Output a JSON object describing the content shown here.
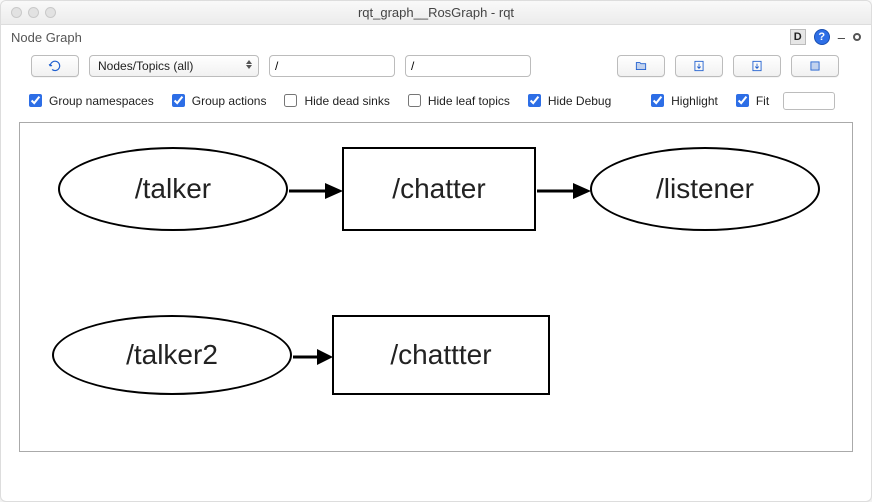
{
  "window": {
    "title": "rqt_graph__RosGraph - rqt",
    "panel_label": "Node Graph",
    "d_button": "D",
    "help_button": "?",
    "minimize": "–",
    "restore": "O"
  },
  "toolbar": {
    "dropdown_value": "Nodes/Topics (all)",
    "filter1": "/",
    "filter2": "/"
  },
  "checks": {
    "group_namespaces": "Group namespaces",
    "group_actions": "Group actions",
    "hide_dead_sinks": "Hide dead sinks",
    "hide_leaf_topics": "Hide leaf topics",
    "hide_debug": "Hide Debug",
    "highlight": "Highlight",
    "fit": "Fit"
  },
  "check_states": {
    "group_namespaces": true,
    "group_actions": true,
    "hide_dead_sinks": false,
    "hide_leaf_topics": false,
    "hide_debug": true,
    "highlight": true,
    "fit": true
  },
  "graph": {
    "nodes": {
      "talker": "/talker",
      "chatter": "/chatter",
      "listener": "/listener",
      "talker2": "/talker2",
      "chattter": "/chattter"
    }
  }
}
